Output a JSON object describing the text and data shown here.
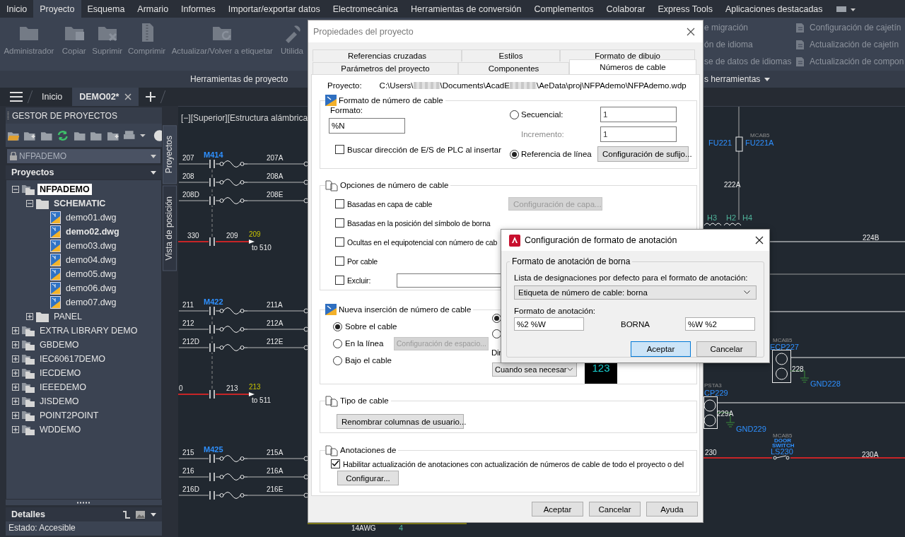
{
  "menu": [
    {
      "label": "Inicio",
      "selected": false
    },
    {
      "label": "Proyecto",
      "selected": true
    },
    {
      "label": "Esquema",
      "selected": false
    },
    {
      "label": "Armario",
      "selected": false
    },
    {
      "label": "Informes",
      "selected": false
    },
    {
      "label": "Importar/exportar datos",
      "selected": false
    },
    {
      "label": "Electromecánica",
      "selected": false
    },
    {
      "label": "Herramientas de conversión",
      "selected": false
    },
    {
      "label": "Complementos",
      "selected": false
    },
    {
      "label": "Colaborar",
      "selected": false
    },
    {
      "label": "Express Tools",
      "selected": false
    },
    {
      "label": "Aplicaciones destacadas",
      "selected": false
    }
  ],
  "ribbon": {
    "buttons": [
      "Administrador",
      "Copiar",
      "Suprimir",
      "Comprimir",
      "Actualizar/Volver a etiquetar",
      "Utilida"
    ],
    "panel_label": "Herramientas de proyecto",
    "right_items_a": [
      "e migración",
      "ón de idioma",
      "se de datos de idiomas"
    ],
    "right_items_b": [
      "Configuración de cajetín",
      "Actualización de cajetín",
      "Actualización de compon"
    ],
    "right_panel_label": "s herramientas"
  },
  "doc_tabs": {
    "home": "Inicio",
    "tabs": [
      {
        "label": "DEMO02*",
        "selected": true
      }
    ]
  },
  "project_manager": {
    "title": "GESTOR DE PROYECTOS",
    "current_project": "NFPADEMO",
    "tree_title": "Proyectos",
    "tree": [
      {
        "label": "NFPADEMO",
        "kind": "project",
        "expanded": true,
        "selected": true,
        "active": true,
        "children": [
          {
            "label": "SCHEMATIC",
            "kind": "folder",
            "expanded": true,
            "selected": false,
            "active": true,
            "children": [
              {
                "label": "demo01.dwg",
                "kind": "drawing",
                "selected": false,
                "active": false
              },
              {
                "label": "demo02.dwg",
                "kind": "drawing",
                "selected": false,
                "active": true
              },
              {
                "label": "demo03.dwg",
                "kind": "drawing",
                "selected": false,
                "active": false
              },
              {
                "label": "demo04.dwg",
                "kind": "drawing",
                "selected": false,
                "active": false
              },
              {
                "label": "demo05.dwg",
                "kind": "drawing",
                "selected": false,
                "active": false
              },
              {
                "label": "demo06.dwg",
                "kind": "drawing",
                "selected": false,
                "active": false
              },
              {
                "label": "demo07.dwg",
                "kind": "drawing",
                "selected": false,
                "active": false
              }
            ]
          },
          {
            "label": "PANEL",
            "kind": "folder",
            "expanded": false,
            "selected": false,
            "active": false
          }
        ]
      },
      {
        "label": "EXTRA LIBRARY DEMO",
        "kind": "project",
        "expanded": false,
        "selected": false,
        "active": false
      },
      {
        "label": "GBDEMO",
        "kind": "project",
        "expanded": false,
        "selected": false,
        "active": false
      },
      {
        "label": "IEC60617DEMO",
        "kind": "project",
        "expanded": false,
        "selected": false,
        "active": false
      },
      {
        "label": "IECDEMO",
        "kind": "project",
        "expanded": false,
        "selected": false,
        "active": false
      },
      {
        "label": "IEEEDEMO",
        "kind": "project",
        "expanded": false,
        "selected": false,
        "active": false
      },
      {
        "label": "JISDEMO",
        "kind": "project",
        "expanded": false,
        "selected": false,
        "active": false
      },
      {
        "label": "POINT2POINT",
        "kind": "project",
        "expanded": false,
        "selected": false,
        "active": false
      },
      {
        "label": "WDDEMO",
        "kind": "project",
        "expanded": false,
        "selected": false,
        "active": false
      }
    ],
    "side_tabs": [
      {
        "label": "Proyectos",
        "selected": true
      },
      {
        "label": "Vista de posición",
        "selected": false
      }
    ],
    "details_title": "Detalles",
    "details_status": "Estado: Accesible"
  },
  "canvas": {
    "viewport_label": "[−][Superior][Estructura alámbrica",
    "left_groups": [
      {
        "tag": "M414",
        "wires": [
          {
            "from": "207",
            "to": "207A"
          },
          {
            "from": "208",
            "to": "208A"
          },
          {
            "from": "208D",
            "to": "208E"
          }
        ],
        "link": {
          "from": "330",
          "mid": "209",
          "ref": "209",
          "note": "to 510"
        }
      },
      {
        "tag": "M422",
        "wires": [
          {
            "from": "211",
            "to": "211A"
          },
          {
            "from": "212",
            "to": "212A"
          },
          {
            "from": "212D",
            "to": "212E"
          }
        ],
        "link": {
          "from": "0",
          "mid": "213",
          "ref": "213",
          "note": "to 511"
        }
      },
      {
        "tag": "M425",
        "wires": [
          {
            "from": "215",
            "to": "215A"
          },
          {
            "from": "216",
            "to": "216A"
          },
          {
            "from": "216D",
            "to": "216E"
          }
        ]
      }
    ],
    "labels": [
      {
        "text": "FU221",
        "kind": "device"
      },
      {
        "text": "MCAB5",
        "kind": "catalog"
      },
      {
        "text": "FU221A",
        "kind": "device"
      },
      {
        "text": "222A",
        "kind": "wire"
      },
      {
        "text": "H3",
        "kind": "terminal"
      },
      {
        "text": "H2",
        "kind": "terminal"
      },
      {
        "text": "H4",
        "kind": "terminal"
      },
      {
        "text": "224B",
        "kind": "wire"
      },
      {
        "text": "MCAB5",
        "kind": "catalog"
      },
      {
        "text": "ECP227",
        "kind": "device"
      },
      {
        "text": "228",
        "kind": "wire"
      },
      {
        "text": "GND228",
        "kind": "device"
      },
      {
        "text": "PSTA3",
        "kind": "catalog"
      },
      {
        "text": "CP229",
        "kind": "device"
      },
      {
        "text": "229A",
        "kind": "wire"
      },
      {
        "text": "GND229",
        "kind": "device"
      },
      {
        "text": "230",
        "kind": "wire"
      },
      {
        "text": "MCAB5",
        "kind": "catalog"
      },
      {
        "text": "DOOR",
        "kind": "note"
      },
      {
        "text": "SWITCH",
        "kind": "note"
      },
      {
        "text": "LS230",
        "kind": "device"
      },
      {
        "text": "230A",
        "kind": "wire"
      },
      {
        "text": "14AWG",
        "kind": "wire"
      },
      {
        "text": "4",
        "kind": "terminal"
      }
    ]
  },
  "project_dialog": {
    "title": "Propiedades del proyecto",
    "tab_rows": [
      [
        {
          "label": "Referencias cruzadas",
          "selected": false
        },
        {
          "label": "Estilos",
          "selected": false
        },
        {
          "label": "Formato de dibujo",
          "selected": false
        }
      ],
      [
        {
          "label": "Parámetros del proyecto",
          "selected": false
        },
        {
          "label": "Componentes",
          "selected": false
        },
        {
          "label": "Números de cable",
          "selected": true
        }
      ]
    ],
    "project_label": "Proyecto:",
    "project_path": [
      "C:\\Users\\",
      "\\Documents\\AcadE",
      "\\AeData\\proj\\NFPAdemo\\NFPAdemo.wdp"
    ],
    "format_section": {
      "title": "Formato de número de cable",
      "format_label": "Formato:",
      "format_value": "%N",
      "plc_check": {
        "label": "Buscar dirección de E/S de PLC al insertar",
        "checked": false
      },
      "sequential": {
        "label": "Secuencial:",
        "selected": false
      },
      "start_value": "1",
      "increment_label": "Incremento:",
      "increment_value": "1",
      "line_reference": {
        "label": "Referencia de línea",
        "selected": true
      },
      "suffix_button": "Configuración de sufijo..."
    },
    "options_section": {
      "title": "Opciones de número de cable",
      "checks": [
        {
          "label": "Basadas en capa de cable",
          "checked": false
        },
        {
          "label": "Basadas en la posición del símbolo de borna",
          "checked": false
        },
        {
          "label": "Ocultas en el equipotencial con número de cab",
          "checked": false
        },
        {
          "label": "Por cable",
          "checked": false
        },
        {
          "label": "Excluir:",
          "checked": false
        }
      ],
      "layer_button": {
        "label": "Configuración de capa...",
        "disabled": true
      }
    },
    "insert_section": {
      "title": "Nueva inserción de número de cable",
      "placement": [
        {
          "label": "Sobre el cable",
          "selected": true
        },
        {
          "label": "En la línea",
          "selected": false
        },
        {
          "label": "Bajo el cable",
          "selected": false
        }
      ],
      "spacing_button": {
        "label": "Configuración de espacio...",
        "disabled": true
      },
      "orientation": [
        {
          "selected": true
        },
        {
          "selected": false
        }
      ],
      "direction_label": "Dir",
      "direction_value": "Cuando sea necesar",
      "preview": "123"
    },
    "cable_type_section": {
      "title": "Tipo de cable",
      "rename_button": "Renombrar columnas de usuario..."
    },
    "annotations_section": {
      "title": "Anotaciones de",
      "enable_check": {
        "label": "Habilitar actualización de anotaciones con actualización de números de cable de todo el proyecto o del",
        "checked": true
      },
      "configure_button": "Configurar..."
    },
    "buttons": [
      "Aceptar",
      "Cancelar",
      "Ayuda"
    ]
  },
  "annotation_dialog": {
    "title": "Configuración de formato de anotación",
    "group_title": "Formato de anotación de borna",
    "list_label": "Lista de designaciones por defecto para el formato de anotación:",
    "list_value": "Etiqueta de número de cable: borna",
    "format_label": "Formato de anotación:",
    "left_value": "%2 %W",
    "middle_label": "BORNA",
    "right_value": "%W %2",
    "buttons": [
      {
        "label": "Aceptar",
        "default": true
      },
      {
        "label": "Cancelar",
        "default": false
      }
    ]
  }
}
